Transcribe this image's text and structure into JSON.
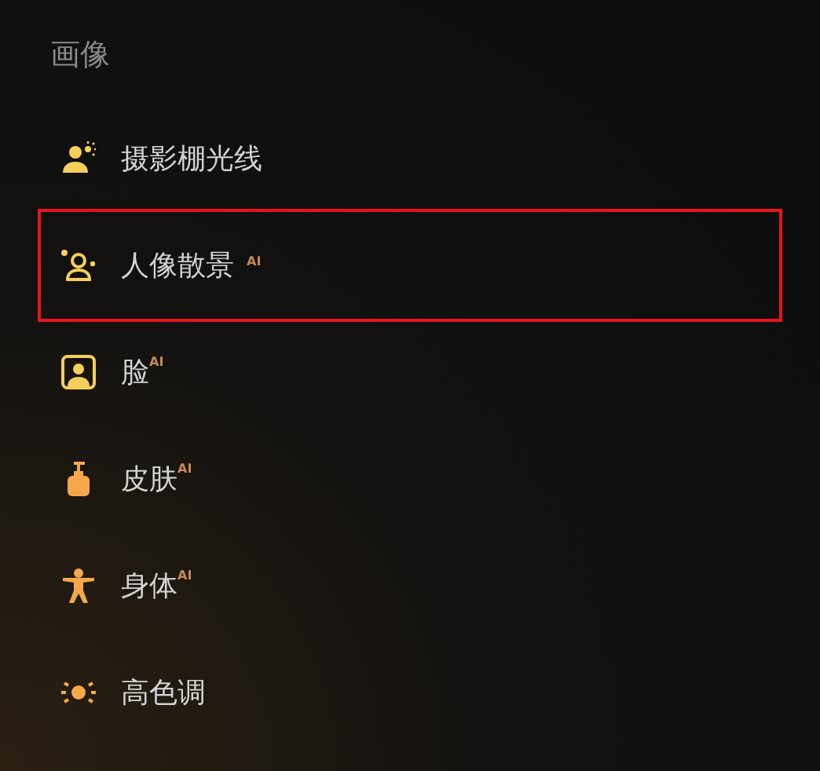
{
  "section": {
    "title": "画像"
  },
  "items": [
    {
      "kind": "studio-light",
      "label": "摄影棚光线",
      "selected": false
    },
    {
      "kind": "portrait-bokeh",
      "label": "人像散景",
      "badge": "AI",
      "selected": true
    },
    {
      "kind": "face",
      "label": "脸",
      "badge": "AI",
      "selected": false
    },
    {
      "kind": "skin",
      "label": "皮肤",
      "badge": "AI",
      "selected": false
    },
    {
      "kind": "body",
      "label": "身体",
      "badge": "AI",
      "selected": false
    },
    {
      "kind": "high-key",
      "label": "高色调",
      "selected": false
    }
  ]
}
